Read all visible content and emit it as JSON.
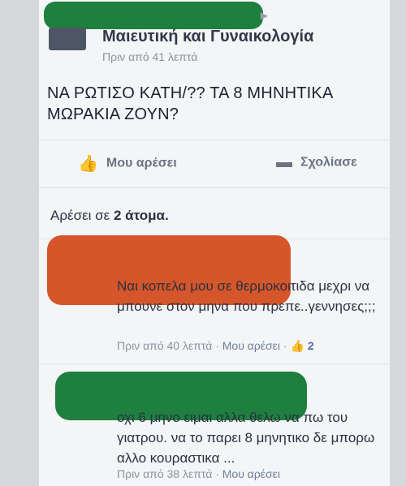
{
  "header": {
    "page_name": "Μαιευτική και Γυναικολογία",
    "post_time": "Πριν από 41 λεπτά"
  },
  "post": {
    "text": "ΝΑ ΡΩΤΙΣΟ ΚΑΤΗ/?? ΤΑ 8 ΜΗΝΗΤΙΚΑ ΜΩΡΑΚΙΑ ΖΟΥΝ?"
  },
  "actions": {
    "like_label": "Μου αρέσει",
    "comment_label": "Σχολίασε"
  },
  "likes": {
    "prefix": "Αρέσει σε",
    "count_text": "2 άτομα."
  },
  "comments": [
    {
      "text": "Ναι κοπελα μου σε θερμοκοιτιδα μεχρι να μπουνε στον μηνα που πρεπε..γεννησες;;;",
      "time": "Πριν από 40 λεπτά",
      "like_label": "Μου αρέσει",
      "likes": "2"
    },
    {
      "text": "οχι 6 μηνο ειμαι αλλα θελω να πω του γιατρου. να το παρει 8 μηνητικο δε μπορω αλλο κουραστικα ...",
      "time": "Πριν από 38 λεπτά",
      "like_label": "Μου αρέσει"
    }
  ],
  "colors": {
    "redaction_green": "#1e7f3e",
    "redaction_orange": "#d5562a",
    "link_blue": "#4b68a8"
  }
}
